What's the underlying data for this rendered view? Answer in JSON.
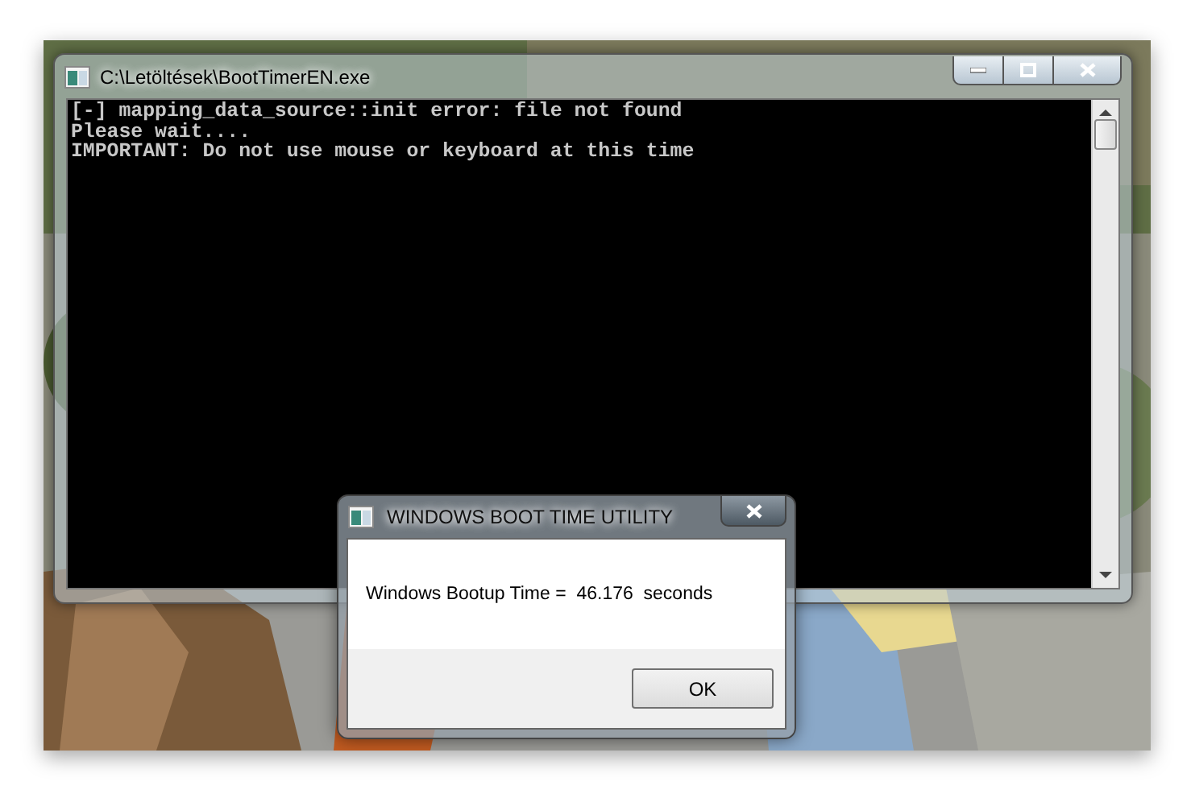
{
  "console_window": {
    "title": "C:\\Letöltések\\BootTimerEN.exe",
    "lines": [
      "[-] mapping_data_source::init error: file not found",
      "Please wait....",
      "IMPORTANT: Do not use mouse or keyboard at this time"
    ]
  },
  "dialog": {
    "title": "WINDOWS BOOT TIME UTILITY",
    "message": "Windows Bootup Time =  46.176  seconds",
    "button": "OK"
  }
}
